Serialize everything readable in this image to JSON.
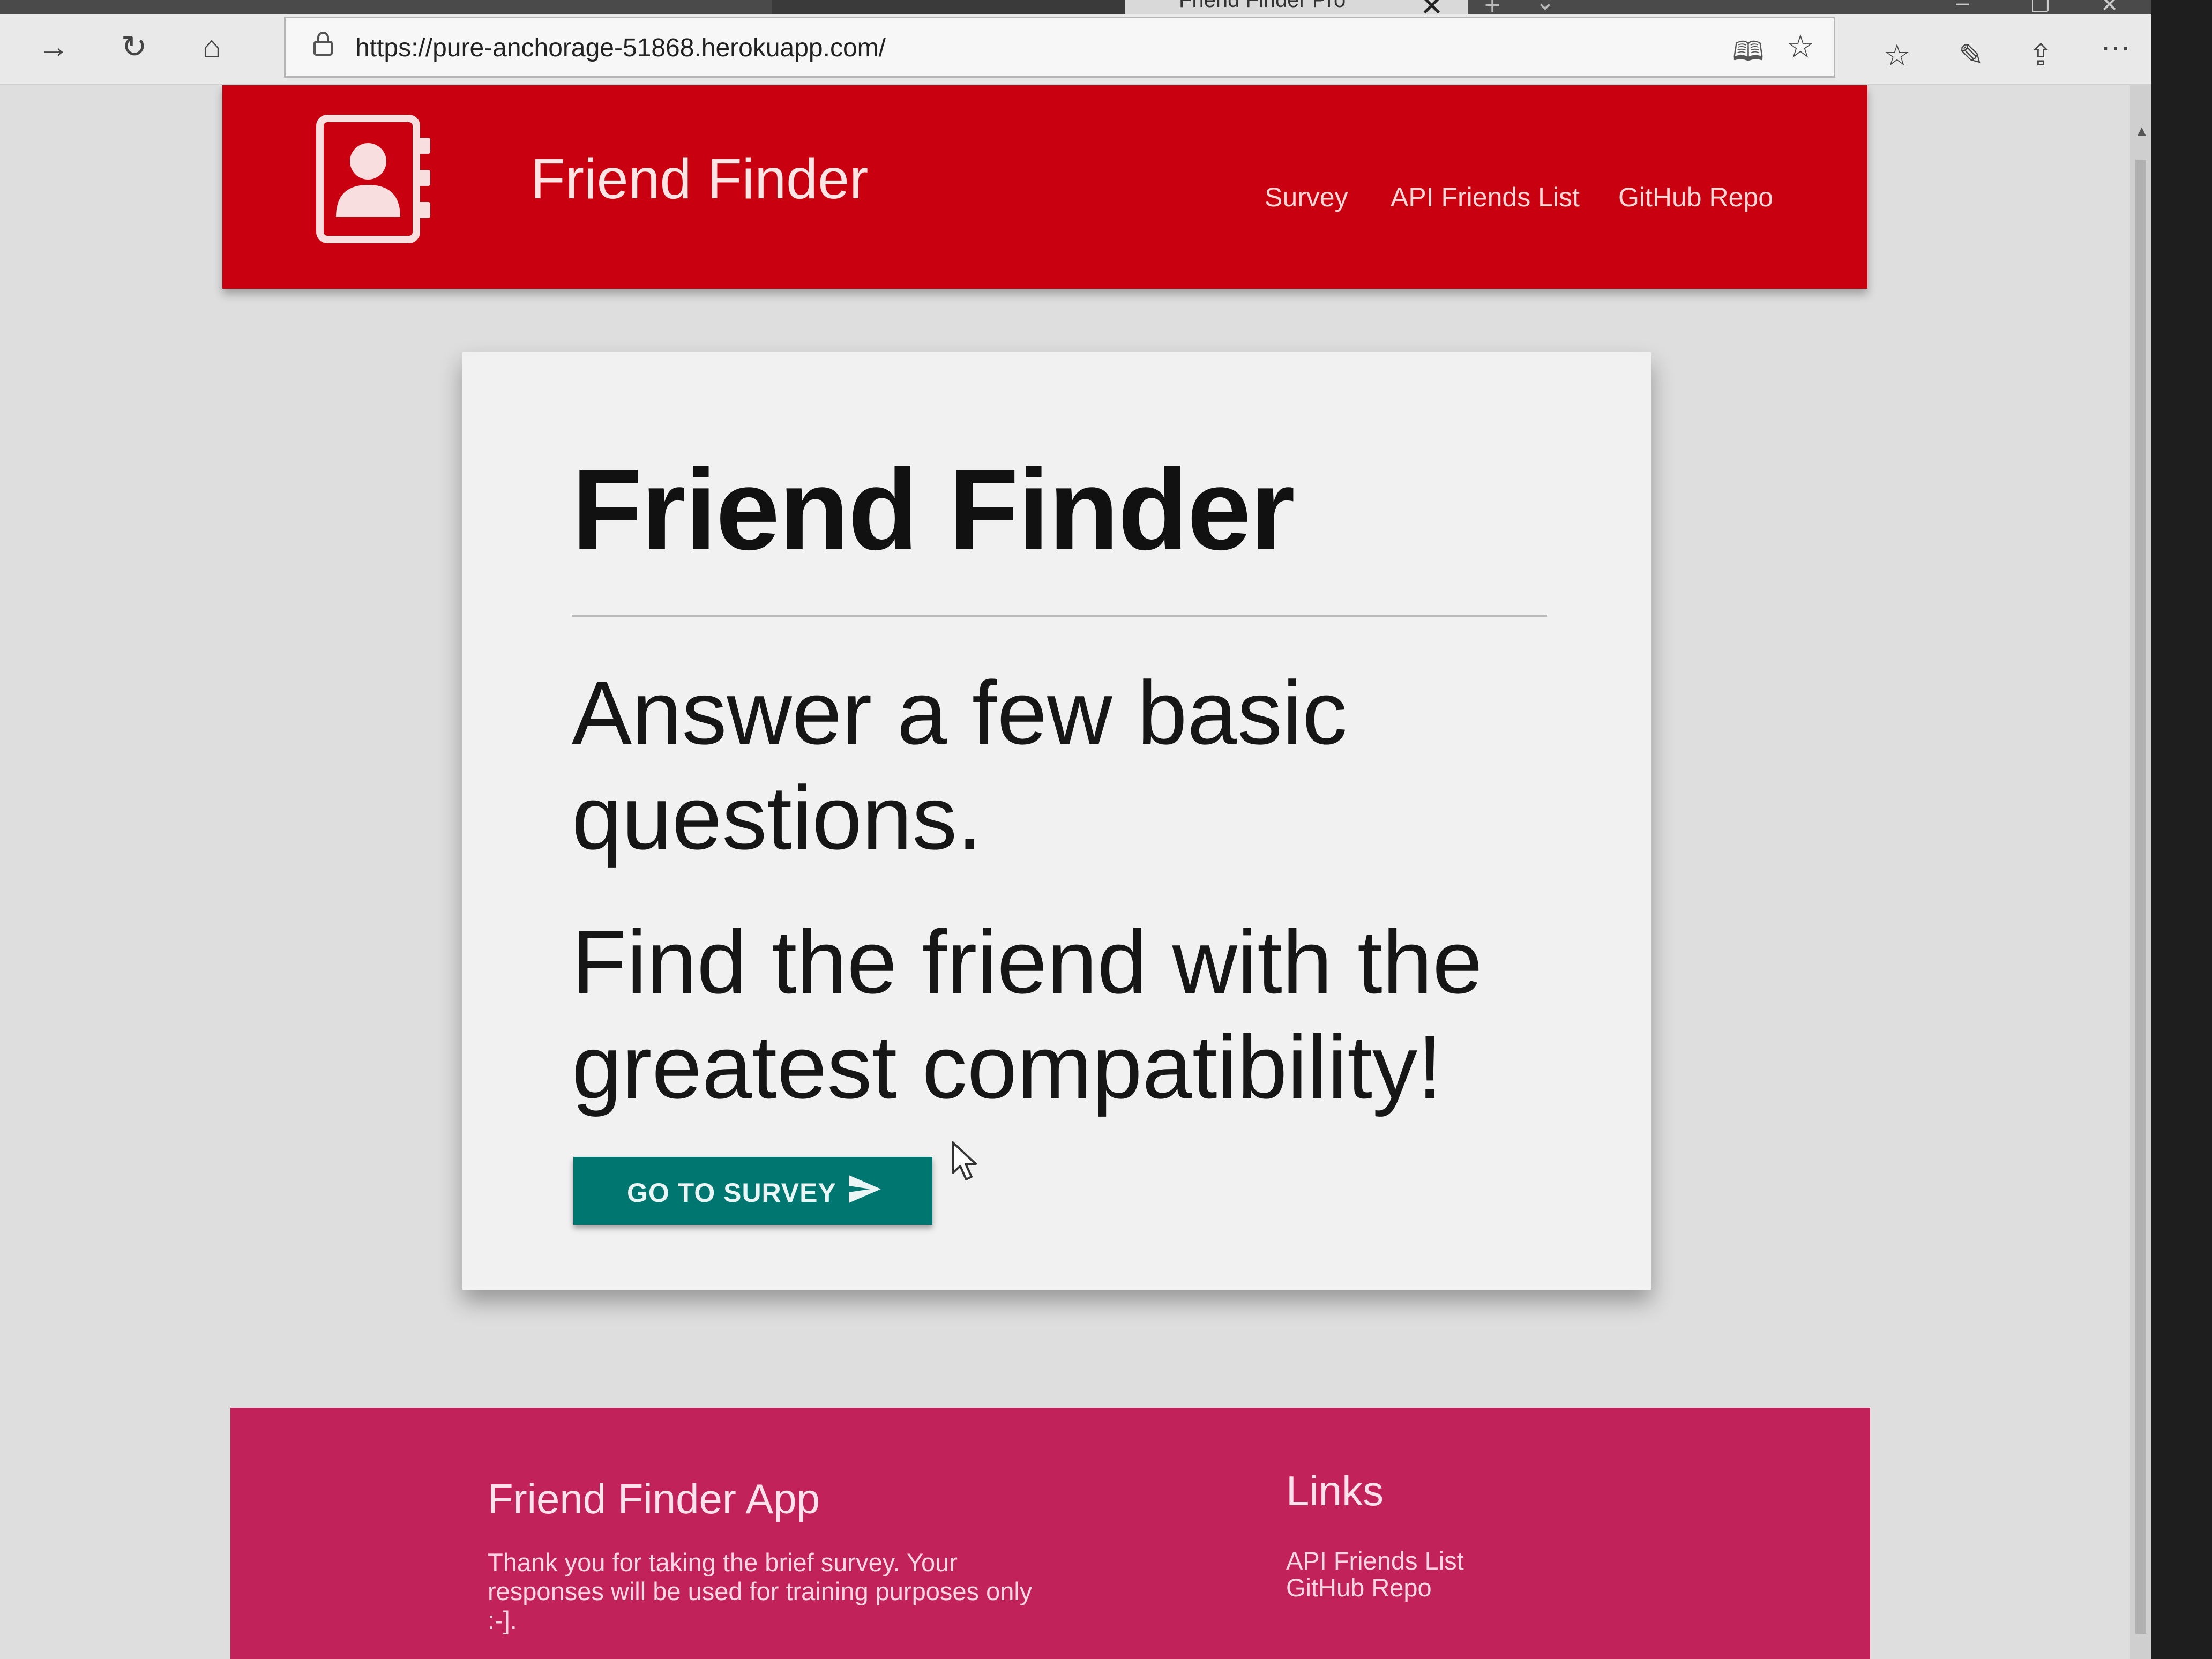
{
  "browser": {
    "active_tab_title": "Friend Finder Pro",
    "url": "https://pure-anchorage-51868.herokuapp.com/",
    "icons": {
      "forward": "arrow-right",
      "refresh": "refresh",
      "home": "home",
      "lock": "lock",
      "reading_view": "book",
      "favorite": "star",
      "favorites_hub": "star-list",
      "notes": "pen",
      "share": "share",
      "more": "ellipsis",
      "tab_close": "close",
      "new_tab": "plus",
      "tab_list": "chevron-down"
    }
  },
  "navbar": {
    "brand": "Friend Finder",
    "logo_icon": "contact-book",
    "links": [
      "Survey",
      "API Friends List",
      "GitHub Repo"
    ]
  },
  "hero": {
    "title": "Friend Finder",
    "line1": "Answer a few basic questions.",
    "line2": "Find the friend with the greatest compatibility!",
    "button_label": "GO TO SURVEY",
    "button_icon": "send"
  },
  "footer": {
    "title": "Friend Finder App",
    "text": "Thank you for taking the brief survey. Your responses will be used for training purposes only :-].",
    "links_title": "Links",
    "links": [
      "API Friends List",
      "GitHub Repo"
    ]
  },
  "colors": {
    "navbar": "#c8000f",
    "button": "#007670",
    "footer": "#c2225a",
    "card": "#f1f1f1",
    "page": "#dedede"
  }
}
